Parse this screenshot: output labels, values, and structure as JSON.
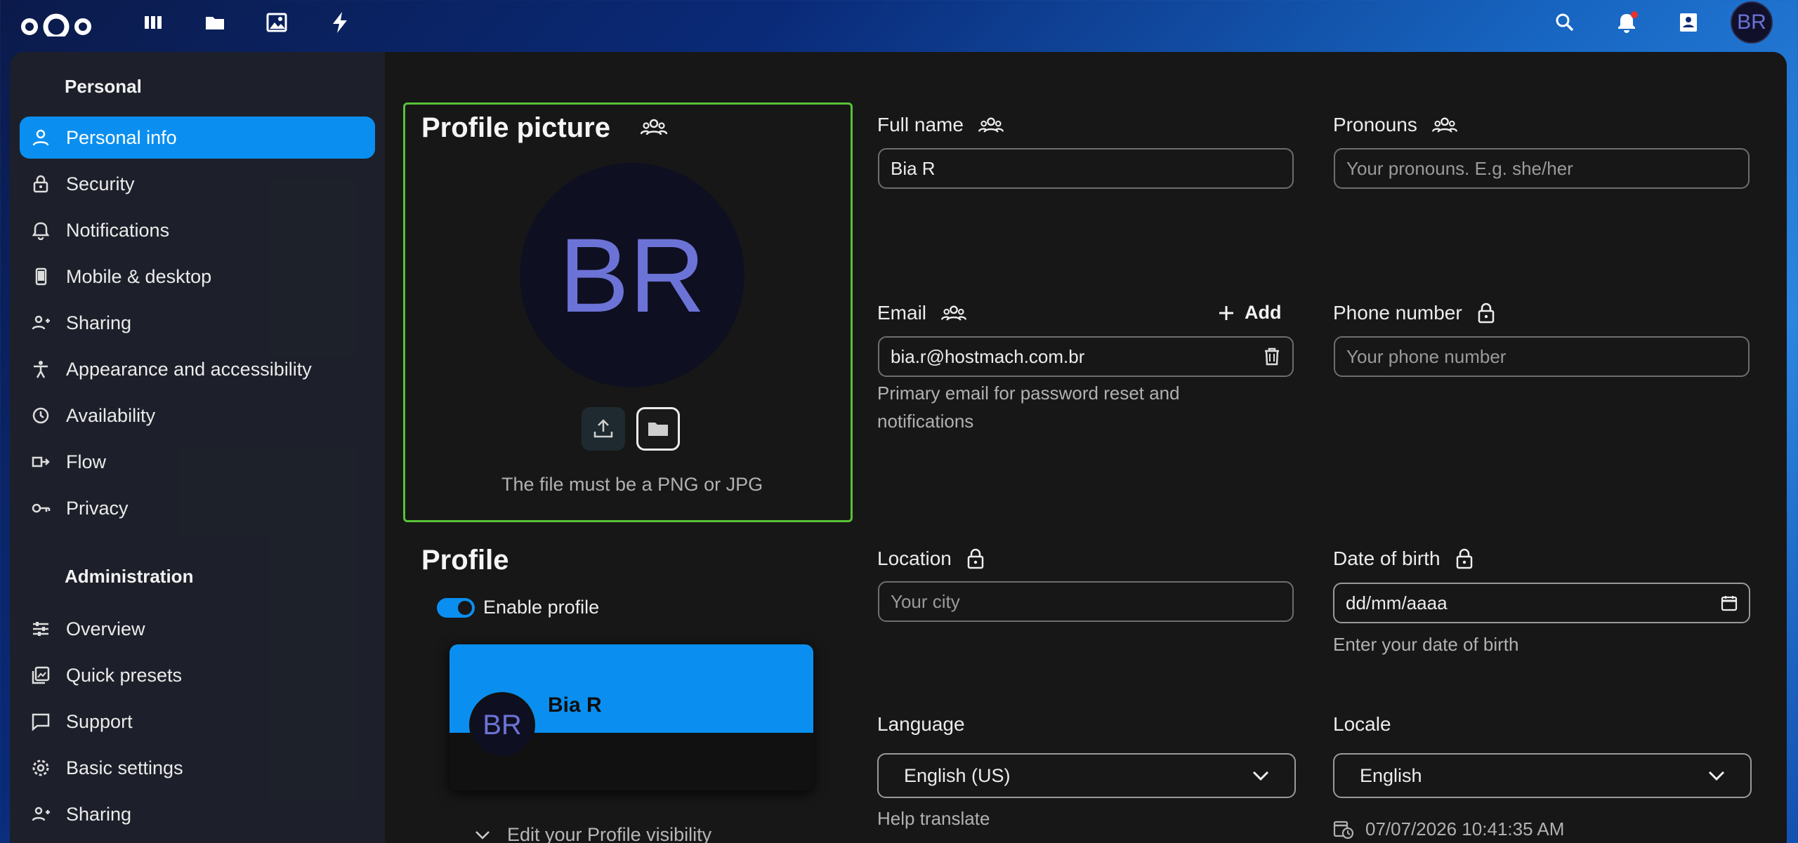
{
  "header": {
    "avatar_initials": "BR",
    "apps": [
      {
        "name": "dashboard"
      },
      {
        "name": "files"
      },
      {
        "name": "photos"
      },
      {
        "name": "activity"
      }
    ]
  },
  "sidebar": {
    "personal_title": "Personal",
    "admin_title": "Administration",
    "personal_items": [
      {
        "label": "Personal info",
        "icon": "person-icon",
        "active": true
      },
      {
        "label": "Security",
        "icon": "lock-icon"
      },
      {
        "label": "Notifications",
        "icon": "bell-icon"
      },
      {
        "label": "Mobile & desktop",
        "icon": "phone-icon"
      },
      {
        "label": "Sharing",
        "icon": "share-icon"
      },
      {
        "label": "Appearance and accessibility",
        "icon": "accessibility-icon"
      },
      {
        "label": "Availability",
        "icon": "clock-icon"
      },
      {
        "label": "Flow",
        "icon": "flow-icon"
      },
      {
        "label": "Privacy",
        "icon": "key-icon"
      }
    ],
    "admin_items": [
      {
        "label": "Overview",
        "icon": "sliders-icon"
      },
      {
        "label": "Quick presets",
        "icon": "presets-icon"
      },
      {
        "label": "Support",
        "icon": "chat-icon"
      },
      {
        "label": "Basic settings",
        "icon": "gear-icon"
      },
      {
        "label": "Sharing",
        "icon": "share-icon"
      }
    ]
  },
  "profile_picture": {
    "title": "Profile picture",
    "initials": "BR",
    "hint": "The file must be a PNG or JPG"
  },
  "profile": {
    "title": "Profile",
    "enable_label": "Enable profile",
    "preview_initials": "BR",
    "preview_name": "Bia R",
    "visibility_label": "Edit your Profile visibility"
  },
  "fields": {
    "full_name": {
      "label": "Full name",
      "value": "Bia R"
    },
    "pronouns": {
      "label": "Pronouns",
      "placeholder": "Your pronouns. E.g. she/her"
    },
    "email": {
      "label": "Email",
      "add_label": "Add",
      "value": "bia.r@hostmach.com.br",
      "hint_line1": "Primary email for password reset and",
      "hint_line2": "notifications"
    },
    "phone": {
      "label": "Phone number",
      "placeholder": "Your phone number"
    },
    "location": {
      "label": "Location",
      "placeholder": "Your city"
    },
    "dob": {
      "label": "Date of birth",
      "placeholder": "dd/mm/aaaa",
      "hint": "Enter your date of birth"
    },
    "language": {
      "label": "Language",
      "value": "English (US)",
      "link": "Help translate"
    },
    "locale": {
      "label": "Locale",
      "value": "English",
      "time": "07/07/2026 10:41:35 AM"
    }
  },
  "colors": {
    "accent": "#0a8ff0",
    "focus": "#58c238"
  }
}
